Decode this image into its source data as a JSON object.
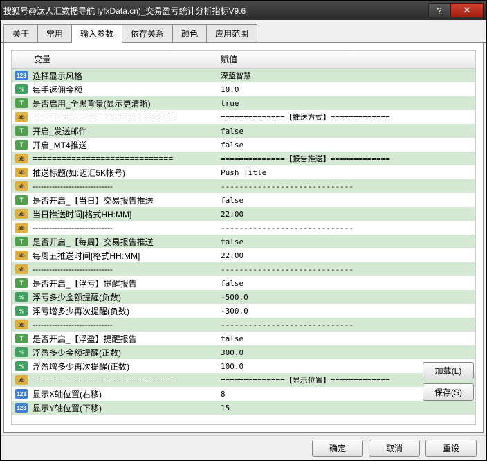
{
  "titlebar": "搜狐号@汰人汇数据导航    lyfxData.cn)_交易盈亏统计分析指标V9.6",
  "tabs": [
    "关于",
    "常用",
    "输入参数",
    "依存关系",
    "颜色",
    "应用范围"
  ],
  "activeTab": 2,
  "headers": {
    "variable": "变量",
    "value": "赋值"
  },
  "rows": [
    {
      "icon": "123",
      "var": "选择显示风格",
      "val": "深蓝智慧"
    },
    {
      "icon": "v2",
      "var": "每手返佣金额",
      "val": "10.0"
    },
    {
      "icon": "t",
      "var": "是否启用_全黑背景(显示更清晰)",
      "val": "true"
    },
    {
      "icon": "ab",
      "var": "=============================",
      "val": "==============【推送方式】============="
    },
    {
      "icon": "t",
      "var": "开启_发送邮件",
      "val": "false"
    },
    {
      "icon": "t",
      "var": "开启_MT4推送",
      "val": "false"
    },
    {
      "icon": "ab",
      "var": "=============================",
      "val": "==============【报告推送】============="
    },
    {
      "icon": "ab",
      "var": "推送标题(如:迈汇5K帐号)",
      "val": "Push Title"
    },
    {
      "icon": "ab",
      "var": "-----------------------------",
      "val": "-----------------------------"
    },
    {
      "icon": "t",
      "var": "是否开启_【当日】交易报告推送",
      "val": "false"
    },
    {
      "icon": "ab",
      "var": "当日推送时间[格式HH:MM]",
      "val": "22:00"
    },
    {
      "icon": "ab",
      "var": "-----------------------------",
      "val": "-----------------------------"
    },
    {
      "icon": "t",
      "var": "是否开启_【每周】交易报告推送",
      "val": "false"
    },
    {
      "icon": "ab",
      "var": "每周五推送时间[格式HH:MM]",
      "val": "22:00"
    },
    {
      "icon": "ab",
      "var": "-----------------------------",
      "val": "-----------------------------"
    },
    {
      "icon": "t",
      "var": "是否开启_【浮亏】提醒报告",
      "val": "false"
    },
    {
      "icon": "v2",
      "var": "浮亏多少金额提醒(负数)",
      "val": "-500.0"
    },
    {
      "icon": "v2",
      "var": "浮亏增多少再次提醒(负数)",
      "val": "-300.0"
    },
    {
      "icon": "ab",
      "var": "-----------------------------",
      "val": "-----------------------------"
    },
    {
      "icon": "t",
      "var": "是否开启_【浮盈】提醒报告",
      "val": "false"
    },
    {
      "icon": "v2",
      "var": "浮盈多少金额提醒(正数)",
      "val": "300.0"
    },
    {
      "icon": "v2",
      "var": "浮盈增多少再次提醒(正数)",
      "val": "100.0"
    },
    {
      "icon": "ab",
      "var": "=============================",
      "val": "==============【显示位置】============="
    },
    {
      "icon": "123",
      "var": "显示X轴位置(右移)",
      "val": "8"
    },
    {
      "icon": "123",
      "var": "显示Y轴位置(下移)",
      "val": "15"
    }
  ],
  "buttons": {
    "load": "加载(L)",
    "save": "保存(S)",
    "ok": "确定",
    "cancel": "取消",
    "reset": "重设"
  },
  "iconText": {
    "123": "123",
    "v2": "½",
    "t": "T",
    "ab": "ab"
  }
}
